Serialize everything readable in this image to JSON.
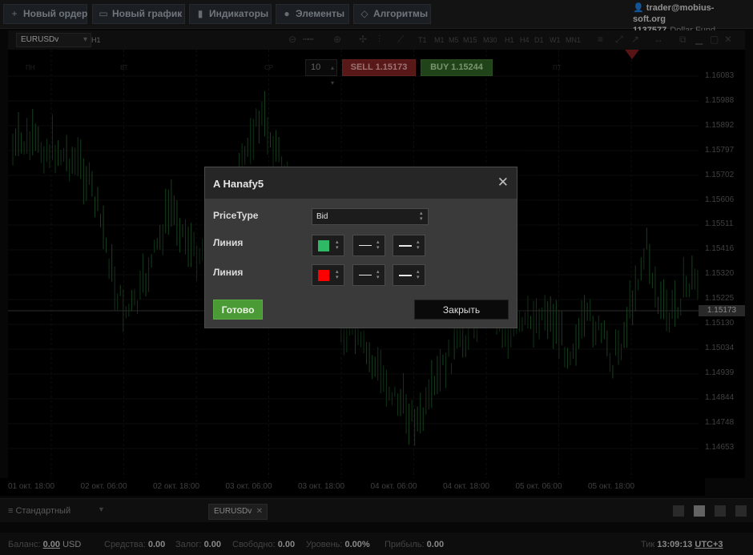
{
  "toolbar": {
    "new_order": "Новый ордер",
    "new_chart": "Новый график",
    "indicators": "Индикаторы",
    "elements": "Элементы",
    "algorithms": "Алгоритмы"
  },
  "account": {
    "user": "trader@mobius-soft.org",
    "id": "1137577",
    "fund": "Dollar Fund"
  },
  "chart_header": {
    "symbol": "EURUSDv",
    "timeframe": "H1",
    "timeframes": [
      "T1",
      "M1",
      "M5",
      "M15",
      "M30",
      "H1",
      "H4",
      "D1",
      "W1",
      "MN1"
    ]
  },
  "order": {
    "quantity": "10",
    "sell": "SELL 1.15173",
    "buy": "BUY 1.15244"
  },
  "y_axis": {
    "ticks": [
      "1.16083",
      "1.15988",
      "1.15892",
      "1.15797",
      "1.15702",
      "1.15606",
      "1.15511",
      "1.15416",
      "1.15320",
      "1.15225",
      "1.15130",
      "1.15034",
      "1.14939",
      "1.14844",
      "1.14748",
      "1.14653"
    ],
    "current_price": "1.15173"
  },
  "x_axis": {
    "ticks": [
      "01 окт. 18:00",
      "02 окт. 06:00",
      "02 окт. 18:00",
      "03 окт. 06:00",
      "03 окт. 18:00",
      "04 окт. 06:00",
      "04 окт. 18:00",
      "05 окт. 06:00",
      "05 окт. 18:00"
    ]
  },
  "modal": {
    "title": "A Hanafy5",
    "price_type_label": "PriceType",
    "price_type_value": "Bid",
    "line1_label": "Линия",
    "line1_color": "#2fb865",
    "line2_label": "Линия",
    "line2_color": "#ff0000",
    "done": "Готово",
    "close": "Закрыть"
  },
  "bottom": {
    "template": "Стандартный",
    "tab": "EURUSDv"
  },
  "status": {
    "balance_label": "Баланс:",
    "balance_value": "0.00",
    "balance_currency": "USD",
    "equity_label": "Средства:",
    "equity_value": "0.00",
    "margin_label": "Залог:",
    "margin_value": "0.00",
    "free_label": "Свободно:",
    "free_value": "0.00",
    "level_label": "Уровень:",
    "level_value": "0.00%",
    "profit_label": "Прибыль:",
    "profit_value": "0.00",
    "tick_label": "Тик",
    "time": "13:09:13",
    "tz": "UTC+3"
  }
}
